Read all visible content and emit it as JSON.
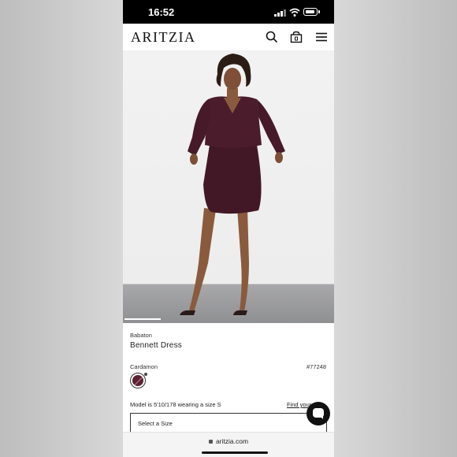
{
  "status_bar": {
    "time": "16:52"
  },
  "header": {
    "logo": "ARITZIA"
  },
  "product": {
    "brand": "Babaton",
    "name": "Bennett Dress",
    "color_name": "Cardamon",
    "sku": "#77248",
    "swatch_color": "#5a2233",
    "model_info": "Model is 5'10/178 wearing a size S",
    "find_size_label": "Find your",
    "size_select_label": "Select a Size"
  },
  "browser": {
    "url": "aritzia.com"
  }
}
